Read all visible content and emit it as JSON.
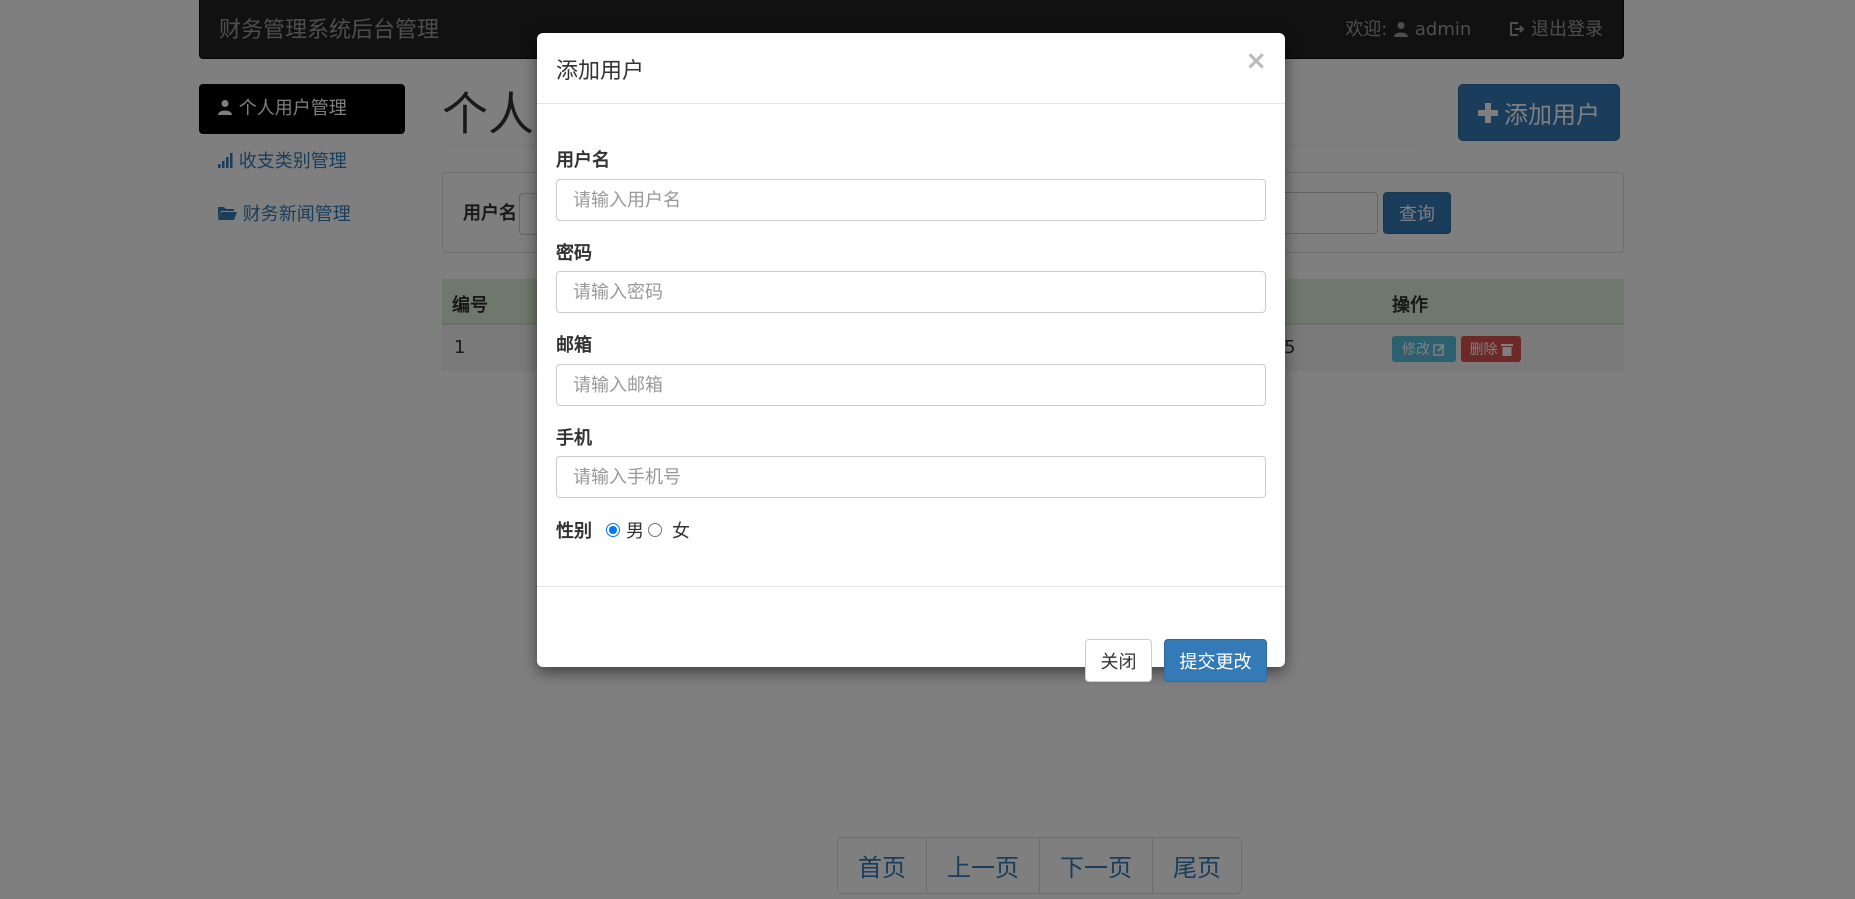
{
  "navbar": {
    "brand": "财务管理系统后台管理",
    "welcome_prefix": "欢迎:",
    "username": "admin",
    "logout_label": "退出登录"
  },
  "sidebar": {
    "items": [
      {
        "label": "个人用户管理",
        "icon": "user-icon",
        "active": true
      },
      {
        "label": "收支类别管理",
        "icon": "signal-bars-icon",
        "active": false
      },
      {
        "label": "财务新闻管理",
        "icon": "folder-open-icon",
        "active": false
      }
    ]
  },
  "main": {
    "title_visible": "个人",
    "add_user_label": "添加用户",
    "search": {
      "label": "用户名",
      "query_label": "查询"
    },
    "table": {
      "headers": [
        "编号",
        "操作"
      ],
      "rows": [
        {
          "id": "1",
          "partial_value": "5",
          "edit_label": "修改",
          "delete_label": "删除"
        }
      ]
    },
    "pager": [
      "首页",
      "上一页",
      "下一页",
      "尾页"
    ]
  },
  "modal": {
    "title": "添加用户",
    "close_symbol": "×",
    "fields": [
      {
        "label": "用户名",
        "placeholder": "请输入用户名",
        "value": ""
      },
      {
        "label": "密码",
        "placeholder": "请输入密码",
        "value": ""
      },
      {
        "label": "邮箱",
        "placeholder": "请输入邮箱",
        "value": ""
      },
      {
        "label": "手机",
        "placeholder": "请输入手机号",
        "value": ""
      }
    ],
    "gender": {
      "label": "性别",
      "options": [
        "男",
        "女"
      ],
      "selected": "男"
    },
    "close_label": "关闭",
    "submit_label": "提交更改"
  },
  "colors": {
    "primary": "#337ab7",
    "navbar_bg": "#222222",
    "table_head_bg": "#dff0d8",
    "info": "#5bc0de",
    "danger": "#d9534f"
  }
}
